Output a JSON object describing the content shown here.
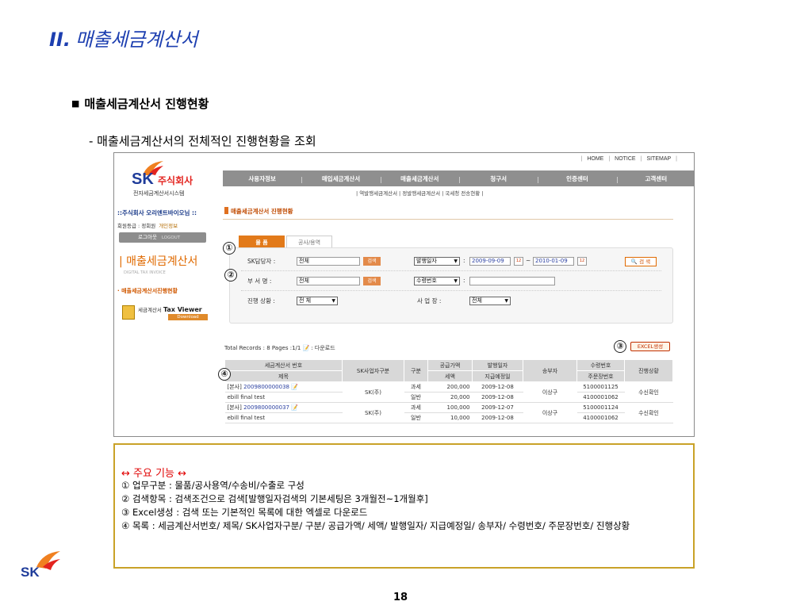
{
  "slide": {
    "title_num": "II.",
    "title_text": "매출세금계산서",
    "section_head": "매출세금계산서 진행현황",
    "section_sub": "- 매출세금계산서의 전체적인 진행현황을 조회",
    "page_number": "18"
  },
  "screenshot": {
    "top_links": [
      "HOME",
      "NOTICE",
      "SITEMAP"
    ],
    "logo": {
      "sk": "SK",
      "corp": "주식회사",
      "system": "전자세금계산서시스템"
    },
    "nav": [
      "사용자정보",
      "매입세금계산서",
      "매출세금계산서",
      "청구서",
      "인증센터",
      "고객센터"
    ],
    "subnav": [
      "역발행세금계산서",
      "정발행세금계산서",
      "국세청 전송현황"
    ],
    "sidebar": {
      "user": "::주식회사 오리엔트바이오님 ::",
      "grade": "회원등급 : 정회원",
      "myinfo": "개인정보",
      "logout": "로그아웃",
      "logout_en": "LOGOUT",
      "section_title": "매출세금계산서",
      "section_title_en": "DIGITAL TAX INVOICE",
      "menu_item": "· 매출세금계산서진행현황",
      "tax_viewer_small": "세금계산서",
      "tax_viewer": "Tax Viewer",
      "download": "Download"
    },
    "main": {
      "page_head": "매출세금계산서 진행현황",
      "tabs": [
        "물 품",
        "공사/용역"
      ],
      "search": {
        "row1": {
          "label": "SK담당자 :",
          "value": "전체",
          "btn": "검색",
          "sel": "발행일자",
          "date_from": "2009-09-09",
          "tilde": "~",
          "date_to": "2010-01-09",
          "search_btn": "검 색"
        },
        "row2": {
          "label": "부 서 명 :",
          "value": "전체",
          "btn": "검색",
          "sel": "수령번호"
        },
        "row3": {
          "label": "진행 상황 :",
          "value": "전 체",
          "label2": "사 업 장 :",
          "value2": "전체"
        }
      },
      "records": "Total Records : 8  Pages :1/1",
      "download": ": 다운로드",
      "excel_btn": "EXCEL생성",
      "table": {
        "h1": [
          "세금계산서 번호",
          "SK사업자구분",
          "구분",
          "공급가액",
          "발행일자",
          "송부자",
          "수령번호",
          "진행상황"
        ],
        "h2": [
          "제목",
          "세액",
          "지급예정일",
          "주문장번호"
        ],
        "rows": [
          {
            "no_prefix": "[본사]",
            "no": "2009800000038",
            "title": "ebill final test",
            "biz": "SK(주)",
            "type1": "과세",
            "type2": "일반",
            "amount": "200,000",
            "tax": "20,000",
            "issue": "2009-12-08",
            "pay": "2009-12-08",
            "sender": "이상구",
            "recv": "5100001125",
            "order": "4100001062",
            "status": "수신확인"
          },
          {
            "no_prefix": "[본사]",
            "no": "2009800000037",
            "title": "ebill final test",
            "biz": "SK(주)",
            "type1": "과세",
            "type2": "일반",
            "amount": "100,000",
            "tax": "10,000",
            "issue": "2009-12-07",
            "pay": "2009-12-08",
            "sender": "이상구",
            "recv": "5100001124",
            "order": "4100001062",
            "status": "수신확인"
          }
        ]
      }
    }
  },
  "badges": [
    "①",
    "②",
    "③",
    "④"
  ],
  "notes": {
    "head": "↔  주요 기능 ↔",
    "lines": [
      "① 업무구분 : 물품/공사용역/수송비/수출로 구성",
      "② 검색항목 : 검색조건으로 검색[발행일자검색의 기본세팅은 3개월전~1개월후]",
      "③ Excel생성 : 검색 또는 기본적인 목록에 대한 엑셀로 다운로드",
      "④ 목록 : 세금계산서번호/ 제목/ SK사업자구분/ 구분/ 공급가액/ 세액/ 발행일자/ 지급예정일/ 송부자/ 수령번호/ 주문장번호/ 진행상황"
    ]
  },
  "footer_logo": "SK"
}
